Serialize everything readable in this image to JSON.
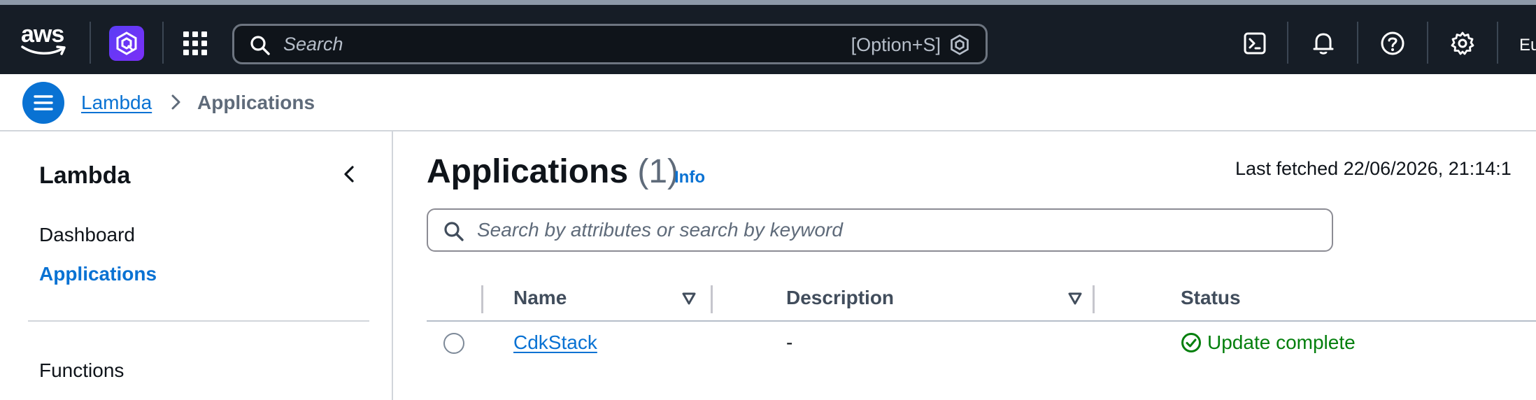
{
  "topnav": {
    "logo_text": "aws",
    "search_placeholder": "Search",
    "search_shortcut": "[Option+S]",
    "region_fragment": "Eu",
    "colors": {
      "background": "#161d26",
      "q_gradient_start": "#5a3df5",
      "q_gradient_end": "#7b2ff7"
    },
    "icons": [
      "amazon-q-icon",
      "app-grid-icon",
      "search-icon",
      "cloudshell-icon",
      "bell-icon",
      "help-icon",
      "gear-icon"
    ]
  },
  "breadcrumb": {
    "items": [
      {
        "label": "Lambda"
      },
      {
        "label": "Applications"
      }
    ]
  },
  "sidebar": {
    "title": "Lambda",
    "items": [
      {
        "label": "Dashboard",
        "active": false
      },
      {
        "label": "Applications",
        "active": true
      },
      {
        "label": "Functions",
        "active": false
      }
    ]
  },
  "main": {
    "title": "Applications",
    "count": "(1)",
    "info_label": "Info",
    "last_fetched": "Last fetched 22/06/2026, 21:14:1",
    "filter_placeholder": "Search by attributes or search by keyword",
    "columns": [
      {
        "label": "Name",
        "sortable": true
      },
      {
        "label": "Description",
        "sortable": true
      },
      {
        "label": "Status",
        "sortable": false
      }
    ],
    "rows": [
      {
        "name": "CdkStack",
        "description": "-",
        "status": "Update complete"
      }
    ]
  },
  "colors": {
    "link": "#0972d3",
    "success": "#037f0c",
    "text": "#0f141a",
    "muted": "#5f6b7a"
  }
}
